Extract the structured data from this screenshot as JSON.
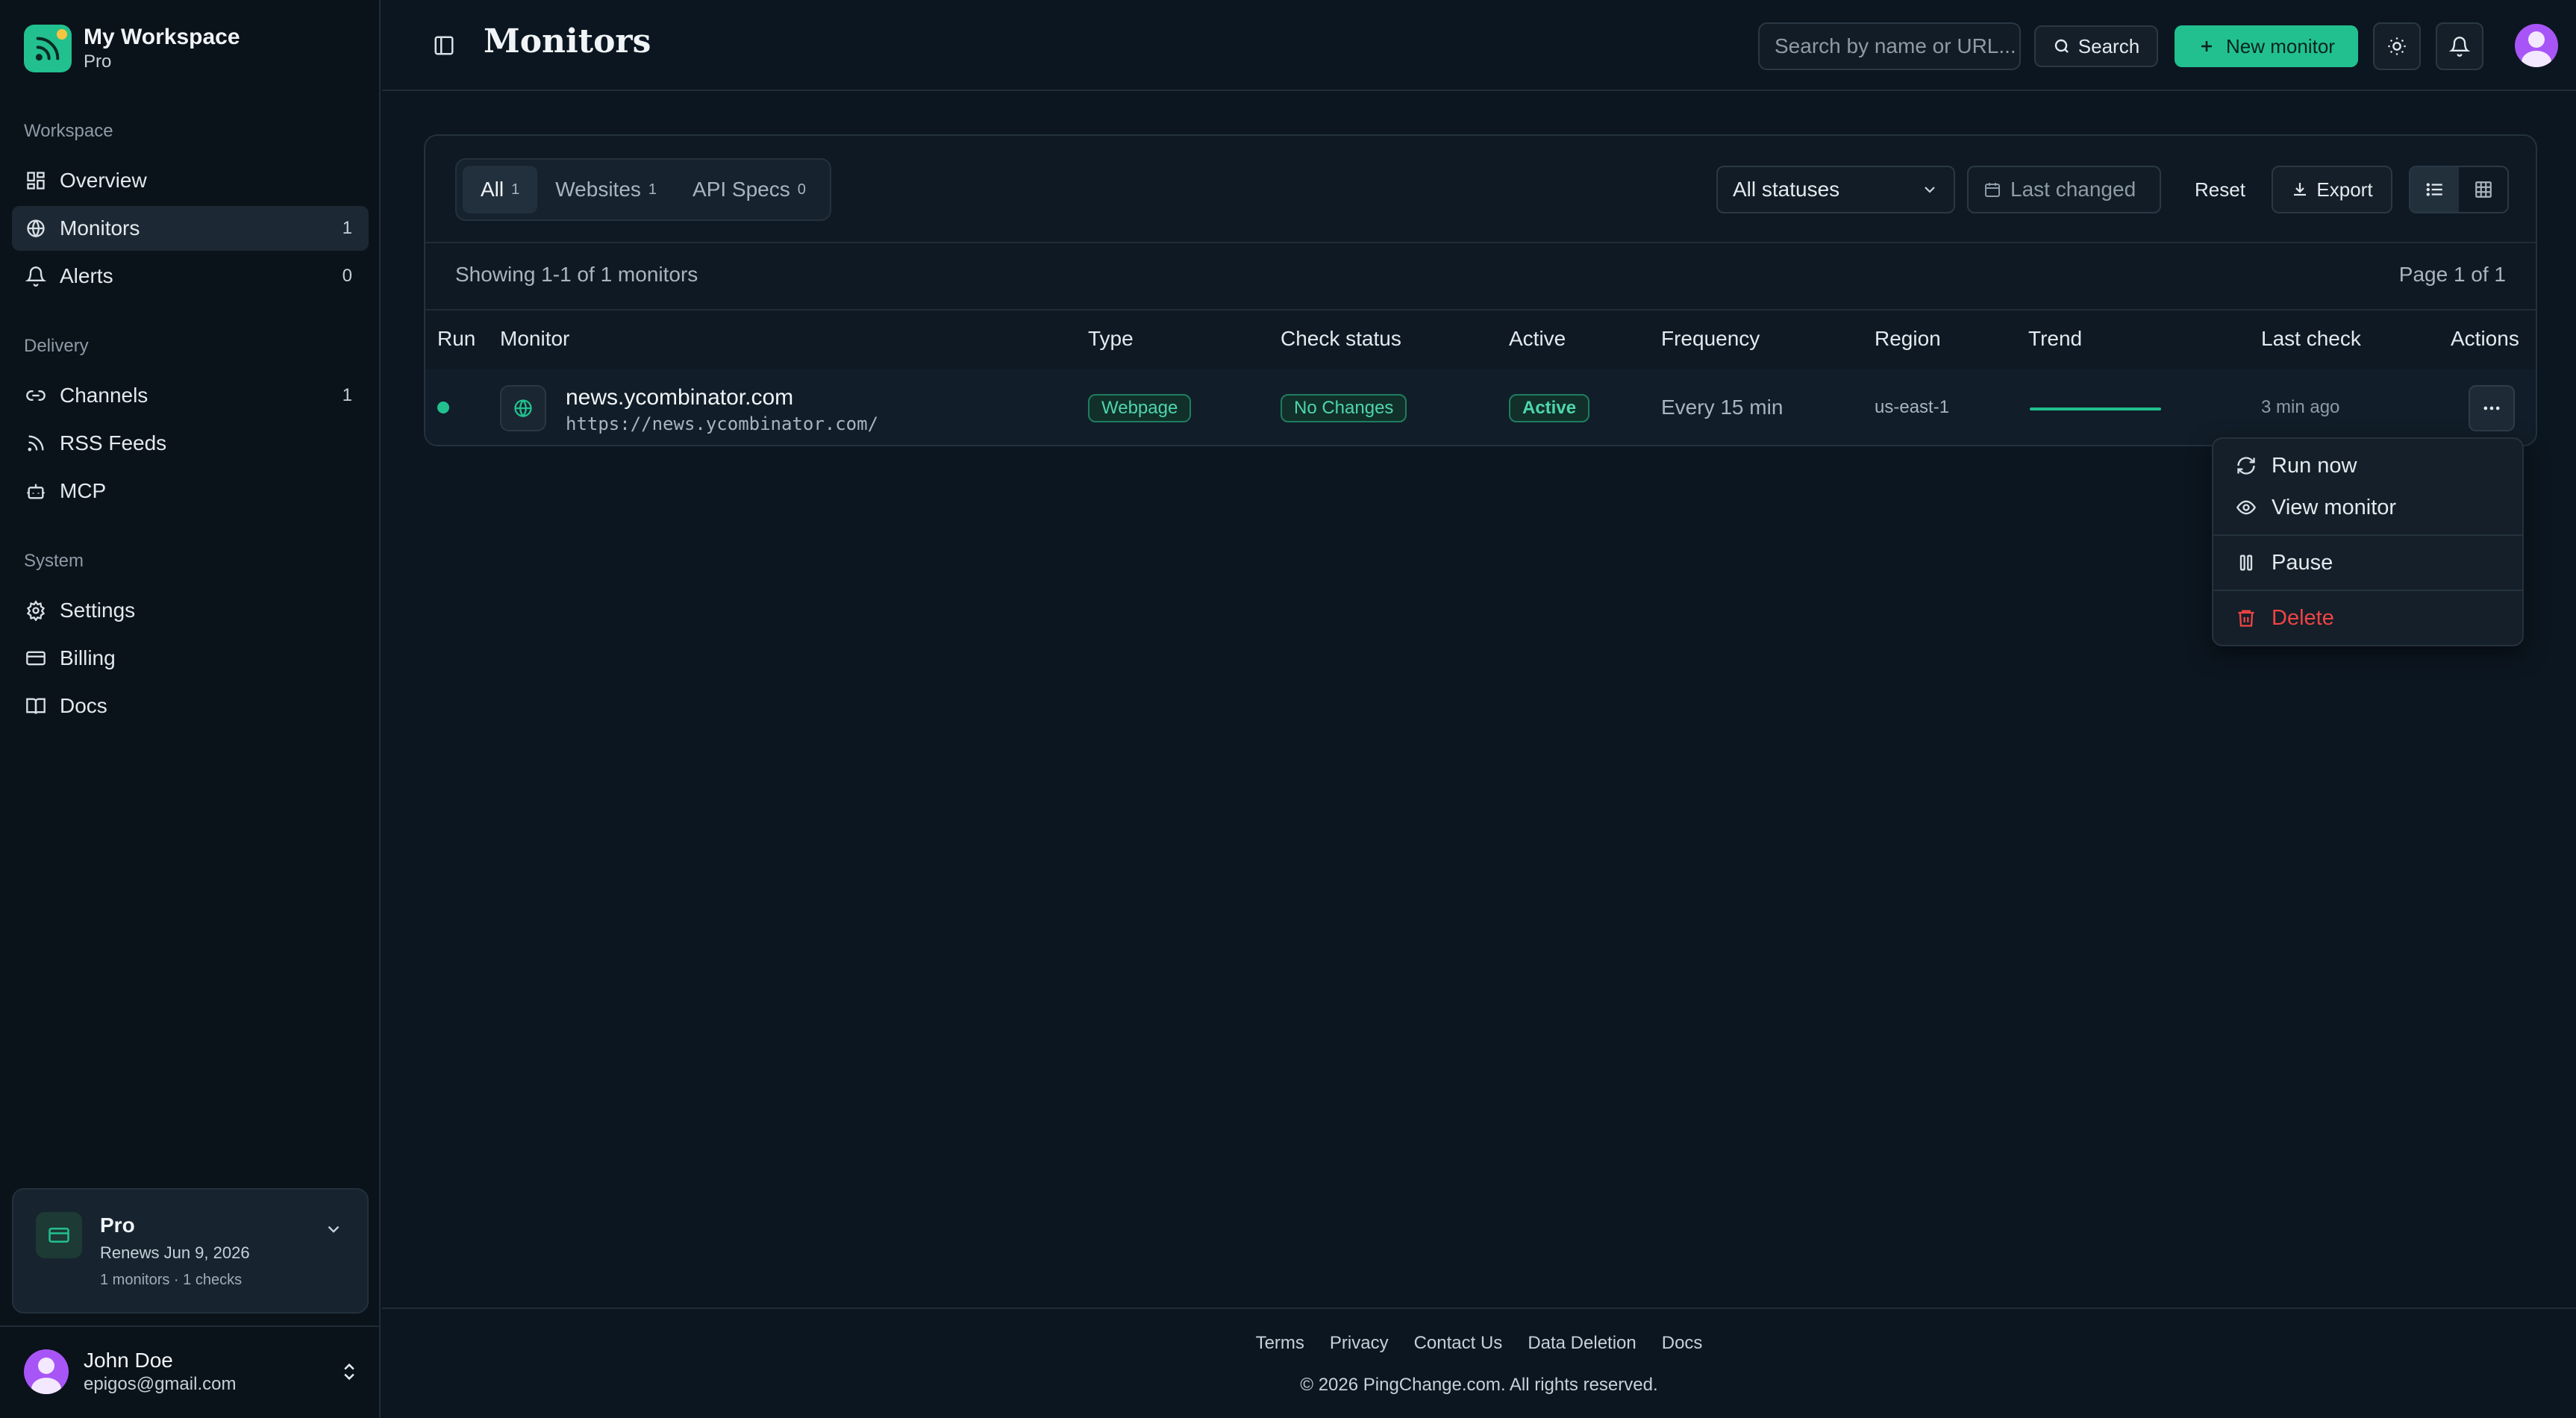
{
  "colors": {
    "accent": "#22c08f",
    "danger": "#ef4444",
    "background": "#0c1620"
  },
  "sidebar": {
    "workspace_name": "My Workspace",
    "workspace_plan": "Pro",
    "sections": [
      {
        "title": "Workspace",
        "items": [
          {
            "label": "Overview",
            "icon": "grid-icon",
            "count": ""
          },
          {
            "label": "Monitors",
            "icon": "globe-icon",
            "count": "1",
            "active": true
          },
          {
            "label": "Alerts",
            "icon": "bell-icon",
            "count": "0"
          }
        ]
      },
      {
        "title": "Delivery",
        "items": [
          {
            "label": "Channels",
            "icon": "link-icon",
            "count": "1"
          },
          {
            "label": "RSS Feeds",
            "icon": "rss-icon",
            "count": ""
          },
          {
            "label": "MCP",
            "icon": "bot-icon",
            "count": ""
          }
        ]
      },
      {
        "title": "System",
        "items": [
          {
            "label": "Settings",
            "icon": "gear-icon",
            "count": ""
          },
          {
            "label": "Billing",
            "icon": "credit-card-icon",
            "count": ""
          },
          {
            "label": "Docs",
            "icon": "book-icon",
            "count": ""
          }
        ]
      }
    ],
    "plan_card": {
      "name": "Pro",
      "renews": "Renews Jun 9, 2026",
      "usage": "1 monitors · 1 checks"
    },
    "user": {
      "name": "John Doe",
      "email": "epigos@gmail.com"
    }
  },
  "header": {
    "title": "Monitors",
    "search_placeholder": "Search by name or URL...",
    "search_button": "Search",
    "new_monitor_button": "New monitor"
  },
  "toolbar": {
    "tabs": [
      {
        "label": "All",
        "count": "1",
        "active": true
      },
      {
        "label": "Websites",
        "count": "1"
      },
      {
        "label": "API Specs",
        "count": "0"
      }
    ],
    "status_filter": "All statuses",
    "date_filter": "Last changed",
    "reset": "Reset",
    "export": "Export"
  },
  "table": {
    "showing": "Showing 1-1 of 1 monitors",
    "page": "Page 1 of 1",
    "columns": [
      "Run",
      "Monitor",
      "Type",
      "Check status",
      "Active",
      "Frequency",
      "Region",
      "Trend",
      "Last check",
      "Actions"
    ],
    "rows": [
      {
        "name": "news.ycombinator.com",
        "url": "https://news.ycombinator.com/",
        "type": "Webpage",
        "check_status": "No Changes",
        "active": "Active",
        "frequency": "Every 15 min",
        "region": "us-east-1",
        "last_check": "3 min ago"
      }
    ]
  },
  "actions_menu": {
    "items": [
      {
        "label": "Run now",
        "icon": "refresh-icon"
      },
      {
        "label": "View monitor",
        "icon": "eye-icon"
      },
      {
        "label": "Pause",
        "icon": "pause-icon"
      },
      {
        "label": "Delete",
        "icon": "trash-icon"
      }
    ]
  },
  "footer": {
    "links": [
      "Terms",
      "Privacy",
      "Contact Us",
      "Data Deletion",
      "Docs"
    ],
    "copyright": "© 2026 PingChange.com. All rights reserved."
  }
}
